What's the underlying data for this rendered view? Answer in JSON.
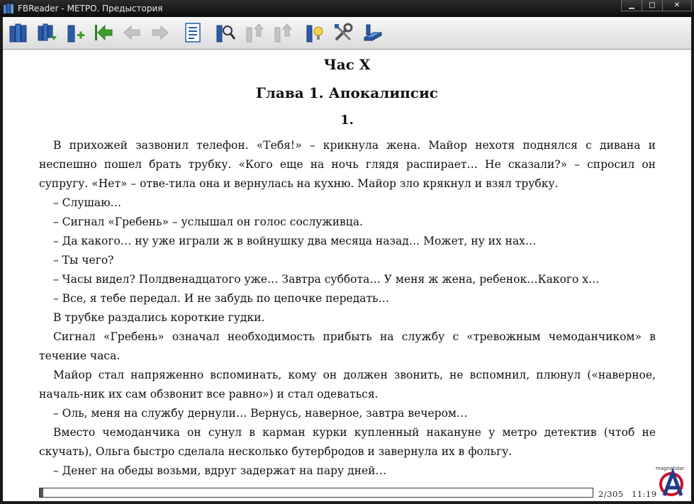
{
  "window": {
    "title": "FBReader - МЕТРО. Предыстория",
    "minimize_glyph": "▁",
    "maximize_glyph": "□",
    "close_glyph": "✕"
  },
  "toolbar": {
    "buttons": [
      {
        "name": "library-icon",
        "enabled": true
      },
      {
        "name": "recent-books-icon",
        "enabled": true
      },
      {
        "name": "add-book-icon",
        "enabled": true
      },
      {
        "name": "go-to-start-icon",
        "enabled": true
      },
      {
        "name": "back-arrow-icon",
        "enabled": false
      },
      {
        "name": "forward-arrow-icon",
        "enabled": false
      },
      {
        "name": "table-of-contents-icon",
        "enabled": true
      },
      {
        "name": "search-icon",
        "enabled": true
      },
      {
        "name": "find-previous-icon",
        "enabled": false
      },
      {
        "name": "find-next-icon",
        "enabled": false
      },
      {
        "name": "book-info-icon",
        "enabled": true
      },
      {
        "name": "settings-icon",
        "enabled": true
      },
      {
        "name": "rotate-screen-icon",
        "enabled": true
      }
    ]
  },
  "book": {
    "part_title": "Час X",
    "chapter_title": "Глава 1. Апокалипсис",
    "section_number": "1.",
    "paragraphs": [
      "В прихожей зазвонил телефон. «Тебя!» – крикнула жена. Майор нехотя поднялся с дивана и неспешно пошел брать трубку. «Кого еще на ночь глядя распирает… Не сказали?» – спросил он супругу. «Нет» – отве-тила она и вернулась на кухню. Майор зло крякнул и взял трубку.",
      "– Слушаю…",
      "– Сигнал «Гребень» – услышал он голос сослуживца.",
      "– Да какого… ну уже играли ж в войнушку два месяца назад… Может, ну их нах…",
      "– Ты чего?",
      "– Часы видел? Полдвенадцатого уже… Завтра суббота… У меня ж жена, ребенок…Какого х…",
      "– Все, я тебе передал. И не забудь по цепочке передать…",
      "В трубке раздались короткие гудки.",
      "Сигнал «Гребень» означал необходимость прибыть на службу с «тревожным чемоданчиком» в течение часа.",
      "Майор стал напряженно вспоминать, кому он должен звонить, не вспомнил, плюнул («наверное, началь-ник их сам обзвонит все равно») и стал одеваться.",
      "– Оль, меня на службу дернули… Вернусь, наверное, завтра вечером…",
      "Вместо чемоданчика он сунул в карман курки купленный накануне у метро детектив (чтоб не скучать), Ольга быстро сделала несколько бутербродов и завернула их в фольгу.",
      "– Денег на обеды возьми, вдруг задержат на пару дней…"
    ]
  },
  "status": {
    "page_position": "2/305",
    "clock": "11:19",
    "progress_fraction": 0.006
  },
  "watermark": {
    "text": "magnetidar"
  },
  "colors": {
    "toolbar_blue": "#2b5aa8",
    "toolbar_green": "#3f9b2b",
    "disabled_gray": "#b8b8b8",
    "watermark_red": "#c8102e"
  }
}
